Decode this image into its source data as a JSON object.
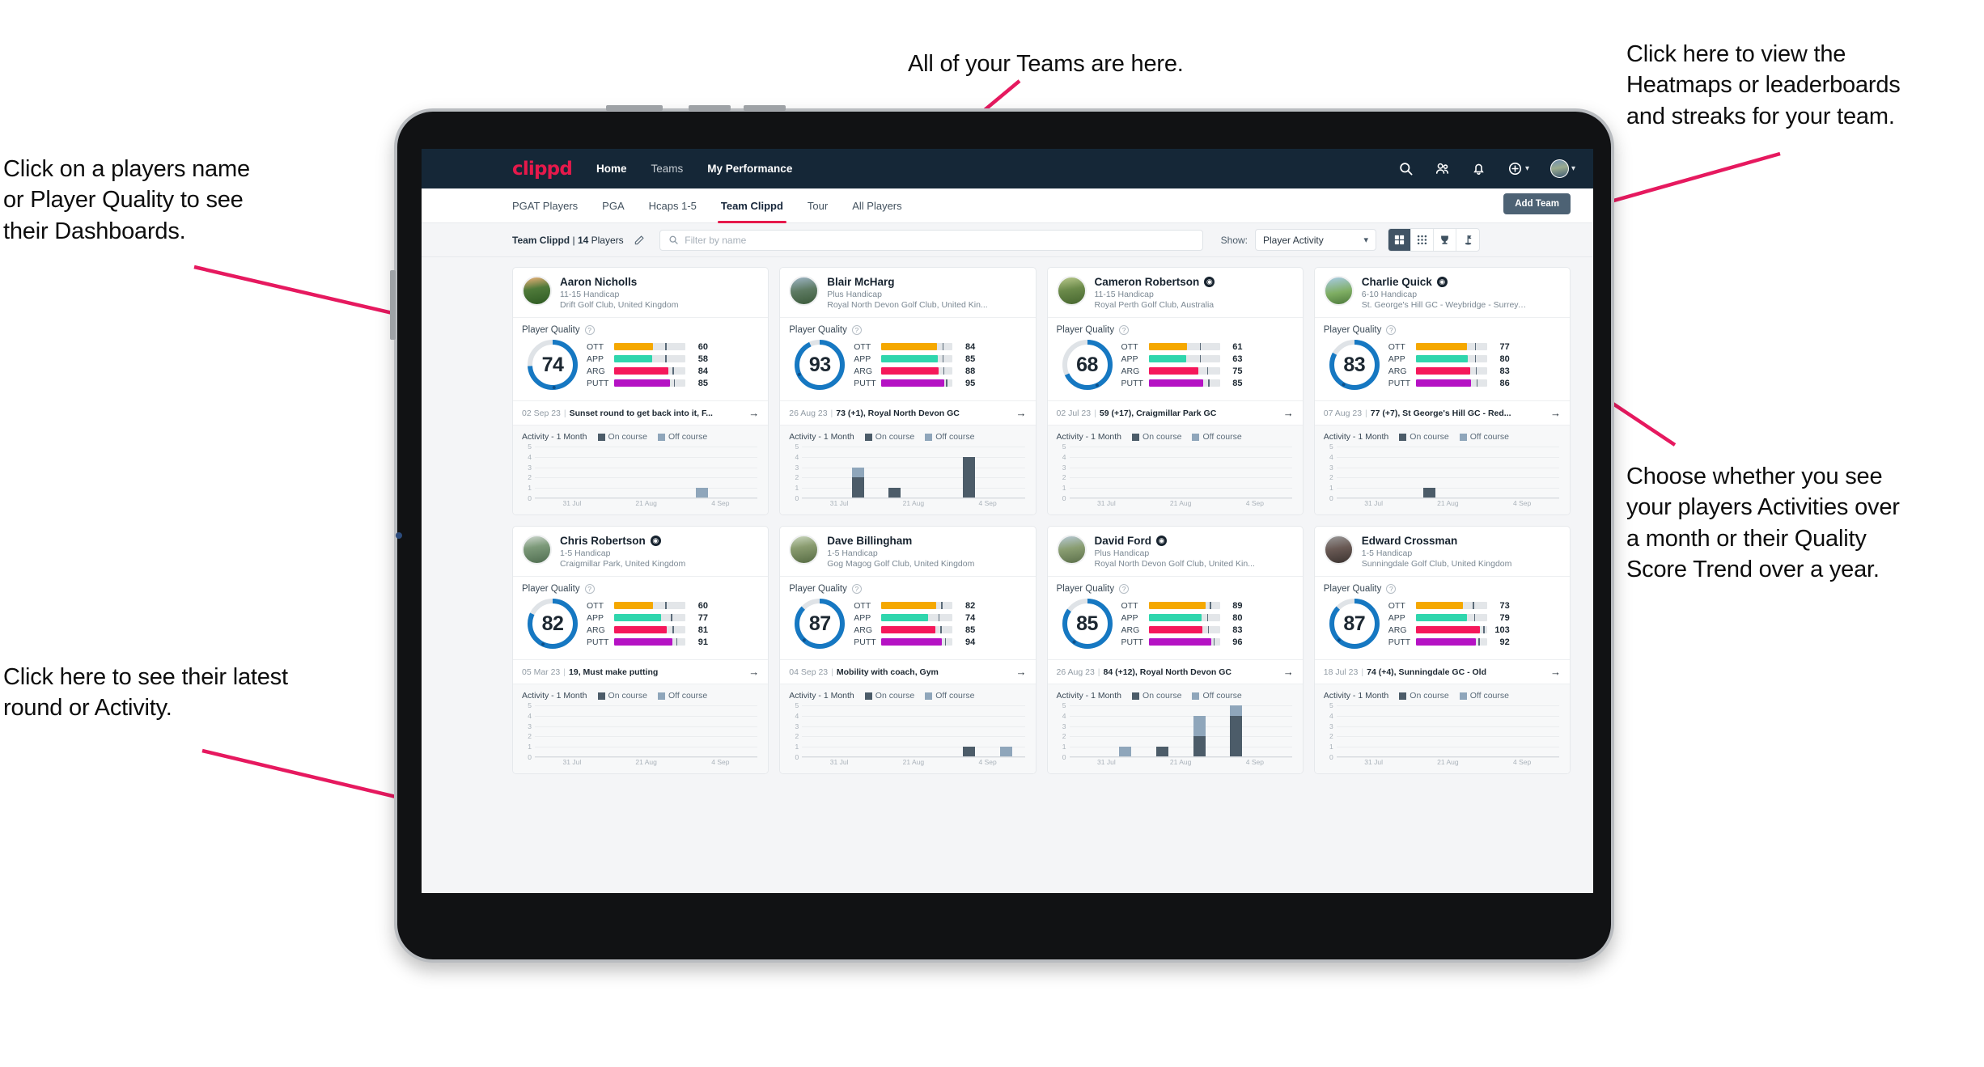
{
  "annotations": [
    {
      "id": "teams",
      "text": "All of your Teams are here."
    },
    {
      "id": "heatmaps",
      "text": "Click here to view the\nHeatmaps or leaderboards\nand streaks for your team."
    },
    {
      "id": "playername",
      "text": "Click on a players name\nor Player Quality to see\ntheir Dashboards."
    },
    {
      "id": "activity_choice",
      "text": "Choose whether you see\nyour players Activities over\na month or their Quality\nScore Trend over a year."
    },
    {
      "id": "latest_round",
      "text": "Click here to see their latest\nround or Activity."
    }
  ],
  "colors": {
    "brand_pink": "#e6194b",
    "navbar": "#152737",
    "donut_blue": "#1678c2",
    "ott": "#f5a800",
    "app": "#2fd6ad",
    "arg": "#f5185b",
    "putt": "#b512c4",
    "on_course": "#4c5c69",
    "off_course": "#8fa6bb"
  },
  "navbar": {
    "brand": "clippd",
    "links": [
      {
        "label": "Home",
        "active": true
      },
      {
        "label": "Teams",
        "active": false
      },
      {
        "label": "My Performance",
        "active": true
      }
    ],
    "icons": [
      "search-icon",
      "people-icon",
      "bell-icon",
      "plus-circle-icon",
      "avatar"
    ]
  },
  "tabs": [
    {
      "label": "PGAT Players",
      "active": false
    },
    {
      "label": "PGA",
      "active": false
    },
    {
      "label": "Hcaps 1-5",
      "active": false
    },
    {
      "label": "Team Clippd",
      "active": true
    },
    {
      "label": "Tour",
      "active": false
    },
    {
      "label": "All Players",
      "active": false
    }
  ],
  "add_team_label": "Add Team",
  "toolbar": {
    "team_name": "Team Clippd",
    "player_count": "14",
    "players_word": "Players",
    "separator": "|",
    "search_placeholder": "Filter by name",
    "search_value": "",
    "show_label": "Show:",
    "show_value": "Player Activity",
    "view_buttons": [
      {
        "name": "grid-view-icon",
        "selected": true
      },
      {
        "name": "dots-grid-view-icon",
        "selected": false
      },
      {
        "name": "trophy-view-icon",
        "selected": false
      },
      {
        "name": "flag-view-icon",
        "selected": false
      }
    ]
  },
  "card_labels": {
    "player_quality": "Player Quality",
    "activity": "Activity - 1 Month",
    "on_course": "On course",
    "off_course": "Off course",
    "metric_labels": [
      "OTT",
      "APP",
      "ARG",
      "PUTT"
    ]
  },
  "chart_data": {
    "type": "bar",
    "title": "Activity - 1 Month",
    "ylabel": "",
    "xlabel": "",
    "ylim": [
      0,
      5
    ],
    "yticks": [
      0,
      1,
      2,
      3,
      4,
      5
    ],
    "categories": [
      "31 Jul",
      "21 Aug",
      "4 Sep"
    ],
    "xtick_labels": [
      "31 Jul",
      "21 Aug",
      "4 Sep"
    ],
    "legend": [
      "On course",
      "Off course"
    ],
    "legend_position": "top",
    "grid": true,
    "note": "Each player card has a 6-slot weekly bar chart; per-player stacked values given under players[].activity"
  },
  "players": [
    {
      "name": "Aaron Nicholls",
      "verified": false,
      "handicap": "11-15 Handicap",
      "club": "Drift Golf Club, United Kingdom",
      "quality": 74,
      "metrics": [
        {
          "label": "OTT",
          "value": 60,
          "fill": 54,
          "tick": 72
        },
        {
          "label": "APP",
          "value": 58,
          "fill": 53,
          "tick": 72
        },
        {
          "label": "ARG",
          "value": 84,
          "fill": 76,
          "tick": 82
        },
        {
          "label": "PUTT",
          "value": 85,
          "fill": 78,
          "tick": 84
        }
      ],
      "latest": {
        "date": "02 Sep 23",
        "text": "Sunset round to get back into it, F..."
      },
      "activity": [
        {
          "on": 0,
          "off": 0
        },
        {
          "on": 0,
          "off": 0
        },
        {
          "on": 0,
          "off": 0
        },
        {
          "on": 0,
          "off": 0
        },
        {
          "on": 0,
          "off": 1
        },
        {
          "on": 0,
          "off": 0
        }
      ]
    },
    {
      "name": "Blair McHarg",
      "verified": false,
      "handicap": "Plus Handicap",
      "club": "Royal North Devon Golf Club, United Kin...",
      "quality": 93,
      "metrics": [
        {
          "label": "OTT",
          "value": 84,
          "fill": 78,
          "tick": 86
        },
        {
          "label": "APP",
          "value": 85,
          "fill": 79,
          "tick": 86
        },
        {
          "label": "ARG",
          "value": 88,
          "fill": 80,
          "tick": 87
        },
        {
          "label": "PUTT",
          "value": 95,
          "fill": 88,
          "tick": 91
        }
      ],
      "latest": {
        "date": "26 Aug 23",
        "text": "73 (+1), Royal North Devon GC"
      },
      "activity": [
        {
          "on": 0,
          "off": 0
        },
        {
          "on": 2,
          "off": 1
        },
        {
          "on": 1,
          "off": 0
        },
        {
          "on": 0,
          "off": 0
        },
        {
          "on": 4,
          "off": 0
        },
        {
          "on": 0,
          "off": 0
        }
      ]
    },
    {
      "name": "Cameron Robertson",
      "verified": true,
      "handicap": "11-15 Handicap",
      "club": "Royal Perth Golf Club, Australia",
      "quality": 68,
      "metrics": [
        {
          "label": "OTT",
          "value": 61,
          "fill": 54,
          "tick": 72
        },
        {
          "label": "APP",
          "value": 63,
          "fill": 53,
          "tick": 72
        },
        {
          "label": "ARG",
          "value": 75,
          "fill": 70,
          "tick": 82
        },
        {
          "label": "PUTT",
          "value": 85,
          "fill": 77,
          "tick": 84
        }
      ],
      "latest": {
        "date": "02 Jul 23",
        "text": "59 (+17), Craigmillar Park GC"
      },
      "activity": [
        {
          "on": 0,
          "off": 0
        },
        {
          "on": 0,
          "off": 0
        },
        {
          "on": 0,
          "off": 0
        },
        {
          "on": 0,
          "off": 0
        },
        {
          "on": 0,
          "off": 0
        },
        {
          "on": 0,
          "off": 0
        }
      ]
    },
    {
      "name": "Charlie Quick",
      "verified": true,
      "handicap": "6-10 Handicap",
      "club": "St. George's Hill GC - Weybridge - Surrey, ...",
      "quality": 83,
      "metrics": [
        {
          "label": "OTT",
          "value": 77,
          "fill": 72,
          "tick": 83
        },
        {
          "label": "APP",
          "value": 80,
          "fill": 73,
          "tick": 83
        },
        {
          "label": "ARG",
          "value": 83,
          "fill": 76,
          "tick": 84
        },
        {
          "label": "PUTT",
          "value": 86,
          "fill": 78,
          "tick": 85
        }
      ],
      "latest": {
        "date": "07 Aug 23",
        "text": "77 (+7), St George's Hill GC - Red..."
      },
      "activity": [
        {
          "on": 0,
          "off": 0
        },
        {
          "on": 0,
          "off": 0
        },
        {
          "on": 1,
          "off": 0
        },
        {
          "on": 0,
          "off": 0
        },
        {
          "on": 0,
          "off": 0
        },
        {
          "on": 0,
          "off": 0
        }
      ]
    },
    {
      "name": "Chris Robertson",
      "verified": true,
      "handicap": "1-5 Handicap",
      "club": "Craigmillar Park, United Kingdom",
      "quality": 82,
      "metrics": [
        {
          "label": "OTT",
          "value": 60,
          "fill": 54,
          "tick": 72
        },
        {
          "label": "APP",
          "value": 77,
          "fill": 66,
          "tick": 80
        },
        {
          "label": "ARG",
          "value": 81,
          "fill": 74,
          "tick": 82
        },
        {
          "label": "PUTT",
          "value": 91,
          "fill": 82,
          "tick": 87
        }
      ],
      "latest": {
        "date": "05 Mar 23",
        "text": "19, Must make putting"
      },
      "activity": [
        {
          "on": 0,
          "off": 0
        },
        {
          "on": 0,
          "off": 0
        },
        {
          "on": 0,
          "off": 0
        },
        {
          "on": 0,
          "off": 0
        },
        {
          "on": 0,
          "off": 0
        },
        {
          "on": 0,
          "off": 0
        }
      ]
    },
    {
      "name": "Dave Billingham",
      "verified": false,
      "handicap": "1-5 Handicap",
      "club": "Gog Magog Golf Club, United Kingdom",
      "quality": 87,
      "metrics": [
        {
          "label": "OTT",
          "value": 82,
          "fill": 77,
          "tick": 84
        },
        {
          "label": "APP",
          "value": 74,
          "fill": 66,
          "tick": 80
        },
        {
          "label": "ARG",
          "value": 85,
          "fill": 76,
          "tick": 83
        },
        {
          "label": "PUTT",
          "value": 94,
          "fill": 85,
          "tick": 89
        }
      ],
      "latest": {
        "date": "04 Sep 23",
        "text": "Mobility with coach, Gym"
      },
      "activity": [
        {
          "on": 0,
          "off": 0
        },
        {
          "on": 0,
          "off": 0
        },
        {
          "on": 0,
          "off": 0
        },
        {
          "on": 0,
          "off": 0
        },
        {
          "on": 1,
          "off": 0
        },
        {
          "on": 0,
          "off": 1
        }
      ]
    },
    {
      "name": "David Ford",
      "verified": true,
      "handicap": "Plus Handicap",
      "club": "Royal North Devon Golf Club, United Kin...",
      "quality": 85,
      "metrics": [
        {
          "label": "OTT",
          "value": 89,
          "fill": 80,
          "tick": 86
        },
        {
          "label": "APP",
          "value": 80,
          "fill": 74,
          "tick": 82
        },
        {
          "label": "ARG",
          "value": 83,
          "fill": 76,
          "tick": 83
        },
        {
          "label": "PUTT",
          "value": 96,
          "fill": 88,
          "tick": 91
        }
      ],
      "latest": {
        "date": "26 Aug 23",
        "text": "84 (+12), Royal North Devon GC"
      },
      "activity": [
        {
          "on": 0,
          "off": 0
        },
        {
          "on": 0,
          "off": 1
        },
        {
          "on": 1,
          "off": 0
        },
        {
          "on": 2,
          "off": 2
        },
        {
          "on": 4,
          "off": 1
        },
        {
          "on": 0,
          "off": 0
        }
      ]
    },
    {
      "name": "Edward Crossman",
      "verified": false,
      "handicap": "1-5 Handicap",
      "club": "Sunningdale Golf Club, United Kingdom",
      "quality": 87,
      "metrics": [
        {
          "label": "OTT",
          "value": 73,
          "fill": 66,
          "tick": 80
        },
        {
          "label": "APP",
          "value": 79,
          "fill": 72,
          "tick": 82
        },
        {
          "label": "ARG",
          "value": 103,
          "fill": 90,
          "tick": 95
        },
        {
          "label": "PUTT",
          "value": 92,
          "fill": 84,
          "tick": 88
        }
      ],
      "latest": {
        "date": "18 Jul 23",
        "text": "74 (+4), Sunningdale GC - Old"
      },
      "activity": [
        {
          "on": 0,
          "off": 0
        },
        {
          "on": 0,
          "off": 0
        },
        {
          "on": 0,
          "off": 0
        },
        {
          "on": 0,
          "off": 0
        },
        {
          "on": 0,
          "off": 0
        },
        {
          "on": 0,
          "off": 0
        }
      ]
    }
  ]
}
